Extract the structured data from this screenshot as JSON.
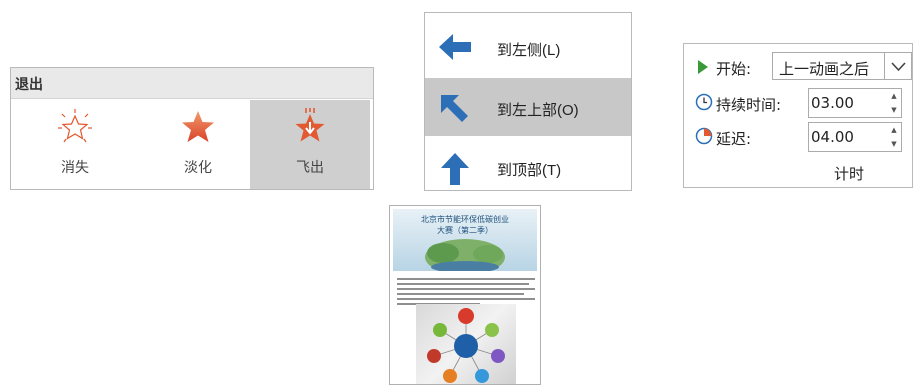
{
  "exit_panel": {
    "header": "退出",
    "effects": [
      {
        "label": "消失",
        "icon": "disappear-star-icon"
      },
      {
        "label": "淡化",
        "icon": "fade-star-icon"
      },
      {
        "label": "飞出",
        "icon": "fly-out-star-icon",
        "selected": true
      }
    ]
  },
  "direction_panel": {
    "options": [
      {
        "label": "到左侧(L)",
        "icon": "arrow-left-icon"
      },
      {
        "label": "到左上部(O)",
        "icon": "arrow-up-left-icon",
        "selected": true
      },
      {
        "label": "到顶部(T)",
        "icon": "arrow-up-icon"
      }
    ]
  },
  "timing_panel": {
    "start_label": "开始:",
    "start_value": "上一动画之后",
    "duration_label": "持续时间:",
    "duration_value": "03.00",
    "delay_label": "延迟:",
    "delay_value": "04.00",
    "caption": "计时"
  },
  "poster": {
    "title_line1": "北京市节能环保低碳创业",
    "title_line2": "大赛（第二季）"
  },
  "colors": {
    "accent_blue": "#2d6fb6",
    "effect_red": "#e4572e",
    "selected_gray": "#cfcfcf",
    "play_green": "#3a9a3a"
  }
}
